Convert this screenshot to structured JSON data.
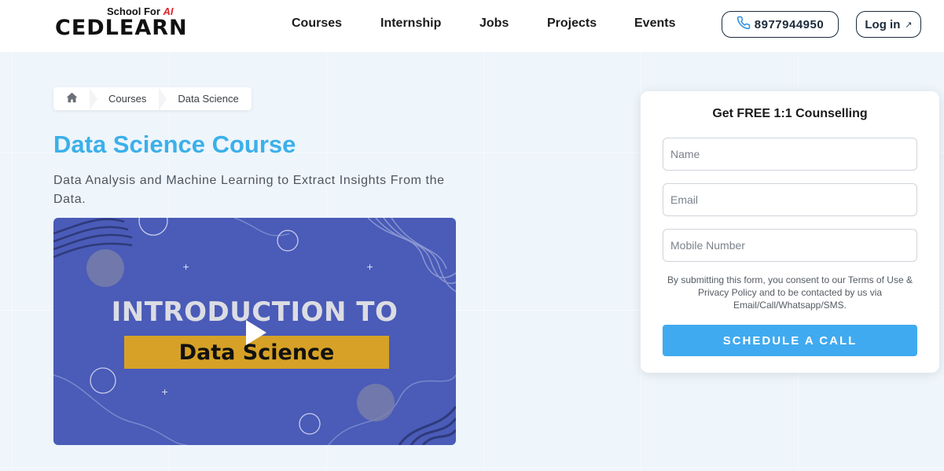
{
  "logo": {
    "tagline_prefix": "School For",
    "tagline_ai": "AI",
    "brand": "CEDLEARN"
  },
  "nav": {
    "items": [
      "Courses",
      "Internship",
      "Jobs",
      "Projects",
      "Events"
    ]
  },
  "header": {
    "phone": "8977944950",
    "login_label": "Log in"
  },
  "breadcrumb": {
    "items": [
      "Courses",
      "Data Science"
    ]
  },
  "hero": {
    "title": "Data Science Course",
    "subtitle": "Data Analysis and Machine Learning to Extract Insights From the Data."
  },
  "video": {
    "title_line1": "INTRODUCTION TO",
    "title_line2": "Data Science"
  },
  "form": {
    "title": "Get FREE 1:1 Counselling",
    "name_placeholder": "Name",
    "email_placeholder": "Email",
    "mobile_placeholder": "Mobile Number",
    "consent": "By submitting this form, you consent to our Terms of Use & Privacy Policy and to be contacted by us via Email/Call/Whatsapp/SMS.",
    "submit_label": "SCHEDULE A CALL"
  },
  "colors": {
    "accent": "#3bb0ea",
    "button": "#40aaf0",
    "video_bg": "#4a5bb8",
    "video_band": "#d6a126"
  }
}
